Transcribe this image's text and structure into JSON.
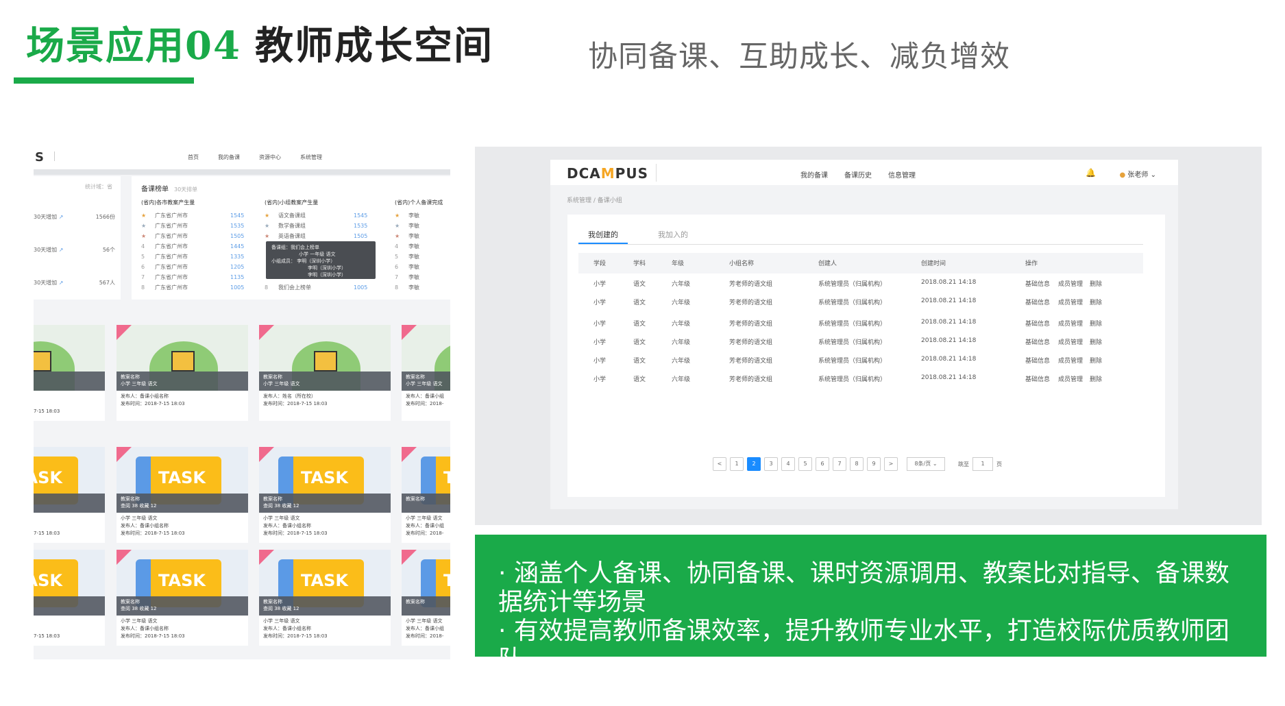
{
  "header": {
    "title_green": "场景应用04",
    "title_black": "教师成长空间",
    "subtitle": "协同备课、互助成长、减负增效"
  },
  "left_app": {
    "logo": "S",
    "nav": [
      "首页",
      "我的备课",
      "资源中心",
      "系统管理"
    ],
    "stats_label": "统计域：省",
    "stats": [
      {
        "label": "30天增加",
        "value": "1566份"
      },
      {
        "label": "30天增加",
        "value": "56个"
      },
      {
        "label": "30天增加",
        "value": "567人"
      }
    ],
    "ranking_title": "备课榜单",
    "ranking_sub": "30天排单",
    "col1": {
      "title": "(省内)各市教案产生量",
      "rows": [
        {
          "n": "1",
          "t": "广东省广州市",
          "v": "1545"
        },
        {
          "n": "2",
          "t": "广东省广州市",
          "v": "1535"
        },
        {
          "n": "3",
          "t": "广东省广州市",
          "v": "1505"
        },
        {
          "n": "4",
          "t": "广东省广州市",
          "v": "1445"
        },
        {
          "n": "5",
          "t": "广东省广州市",
          "v": "1335"
        },
        {
          "n": "6",
          "t": "广东省广州市",
          "v": "1205"
        },
        {
          "n": "7",
          "t": "广东省广州市",
          "v": "1135"
        },
        {
          "n": "8",
          "t": "广东省广州市",
          "v": "1005"
        }
      ]
    },
    "col2": {
      "title": "(省内)小组教案产生量",
      "rows": [
        {
          "n": "1",
          "t": "语文备课组",
          "v": "1545"
        },
        {
          "n": "2",
          "t": "数学备课组",
          "v": "1535"
        },
        {
          "n": "3",
          "t": "英语备课组",
          "v": "1505"
        },
        {
          "n": "8",
          "t": "我们会上榜单",
          "v": "1005"
        }
      ]
    },
    "col3": {
      "title": "(省内)个人备课完成",
      "rows": [
        "李敏",
        "李敏",
        "李敏",
        "李敏",
        "李敏",
        "李敏",
        "李敏",
        "李敏"
      ]
    },
    "tooltip": [
      "备课组：我们会上榜单",
      "小学 一年级 语文",
      "小组成员： 李明（深圳小学）",
      "李明（深圳小学）",
      "李明（深圳小学）"
    ],
    "card_row1": [
      {
        "name": "教案名称",
        "tags": "小学 三年级 语文",
        "publisher": "发布人：备课小组名称",
        "time": "发布时间：2018-7-15 18:03"
      },
      {
        "name": "教案名称",
        "tags": "小学 三年级 语文",
        "publisher": "发布人：姓名（所在校）",
        "time": "发布时间：2018-7-15 18:03"
      },
      {
        "name": "教案名称",
        "tags": "小学 三年级 语文",
        "publisher": "发布人：备课小组",
        "time": "发布时间：2018-"
      }
    ],
    "card_row_task": [
      {
        "name": "教案名称",
        "stats": "查阅 38    收藏 12",
        "tags": "小学 三年级 语文",
        "publisher": "发布人：备课小组名称",
        "time": "发布时间：2018-7-15 18:03"
      },
      {
        "name": "教案名称",
        "stats": "查阅 38    收藏 12",
        "tags": "小学 三年级 语文",
        "publisher": "发布人：备课小组名称",
        "time": "发布时间：2018-7-15 18:03"
      },
      {
        "name": "教案名称",
        "stats": "",
        "tags": "小学 三年级 语文",
        "publisher": "发布人：备课小组",
        "time": "发布时间：2018-"
      }
    ],
    "task_label": "TASK",
    "left_edge_time": "7-15 18:03"
  },
  "right_app": {
    "logo_pre": "DCA",
    "logo_mid": "M",
    "logo_post": "PUS",
    "nav": [
      "我的备课",
      "备课历史",
      "信息管理"
    ],
    "user": "张老师",
    "breadcrumb": "系统管理 / 备课小组",
    "tabs": [
      "我创建的",
      "我加入的"
    ],
    "columns": [
      "学段",
      "学科",
      "年级",
      "小组名称",
      "创建人",
      "创建时间",
      "操作"
    ],
    "rows": [
      [
        "小学",
        "语文",
        "六年级",
        "芳老师的语文组",
        "系统管理员（归属机构）",
        "2018.08.21   14:18"
      ],
      [
        "小学",
        "语文",
        "六年级",
        "芳老师的语文组",
        "系统管理员（归属机构）",
        "2018.08.21   14:18"
      ],
      [
        "小学",
        "语文",
        "六年级",
        "芳老师的语文组",
        "系统管理员（归属机构）",
        "2018.08.21   14:18"
      ],
      [
        "小学",
        "语文",
        "六年级",
        "芳老师的语文组",
        "系统管理员（归属机构）",
        "2018.08.21   14:18"
      ],
      [
        "小学",
        "语文",
        "六年级",
        "芳老师的语文组",
        "系统管理员（归属机构）",
        "2018.08.21   14:18"
      ],
      [
        "小学",
        "语文",
        "六年级",
        "芳老师的语文组",
        "系统管理员（归属机构）",
        "2018.08.21   14:18"
      ]
    ],
    "actions": [
      "基础信息",
      "成员管理",
      "删除"
    ],
    "pager": {
      "prev": "<",
      "next": ">",
      "pages": [
        "1",
        "2",
        "3",
        "4",
        "5",
        "6",
        "7",
        "8",
        "9"
      ],
      "current": "2",
      "per_page": "8条/页",
      "goto": "跳至",
      "goto_value": "1",
      "page_unit": "页"
    }
  },
  "bullets": [
    "· 涵盖个人备课、协同备课、课时资源调用、教案比对指导、备课数据统计等场景",
    "· 有效提高教师备课效率，提升教师专业水平，打造校际优质教师团队"
  ]
}
